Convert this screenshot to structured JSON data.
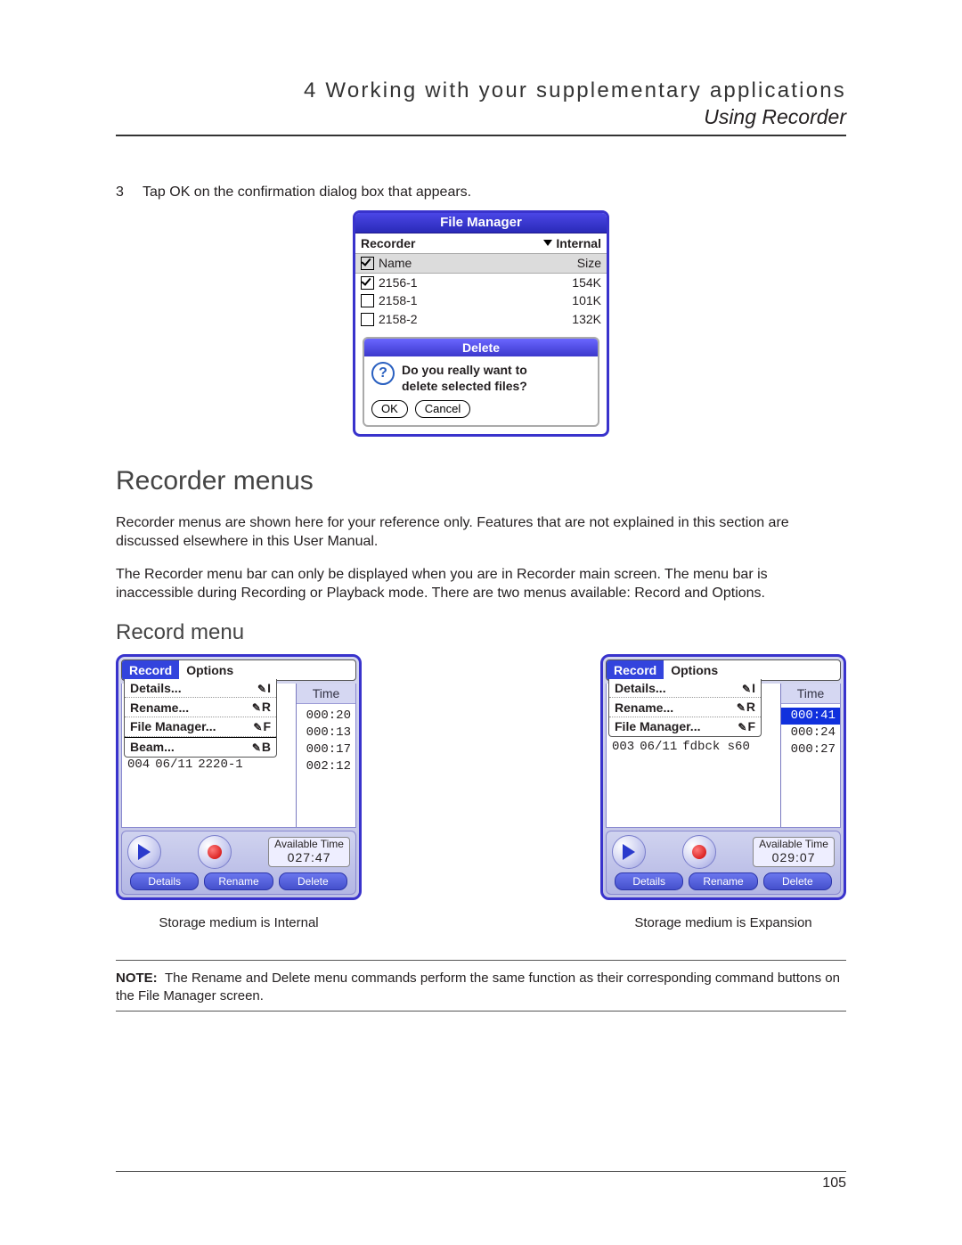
{
  "header": {
    "chapter": "4 Working with your supplementary applications",
    "subtitle": "Using Recorder"
  },
  "step": {
    "num": "3",
    "text": "Tap OK on the confirmation dialog box that appears."
  },
  "filemanager": {
    "title": "File Manager",
    "app": "Recorder",
    "storage": "Internal",
    "cols": {
      "name": "Name",
      "size": "Size"
    },
    "rows": [
      {
        "checked": true,
        "name": "2156-1",
        "size": "154K"
      },
      {
        "checked": false,
        "name": "2158-1",
        "size": "101K"
      },
      {
        "checked": false,
        "name": "2158-2",
        "size": "132K"
      }
    ],
    "dialog": {
      "title": "Delete",
      "line1": "Do you really want to",
      "line2": "delete selected files?",
      "ok": "OK",
      "cancel": "Cancel"
    }
  },
  "section": {
    "title": "Recorder menus",
    "para1": "Recorder menus are shown here for your reference only. Features that are not explained in this section are discussed elsewhere in this User Manual.",
    "para2": "The Recorder menu bar can only be displayed when you are in Recorder main screen. The menu bar is inaccessible during Recording or Playback mode. There are two menus available: Record and Options.",
    "subtitle": "Record menu"
  },
  "menu": {
    "record": "Record",
    "options": "Options",
    "items": {
      "details": {
        "label": "Details...",
        "short": "I"
      },
      "rename": {
        "label": "Rename...",
        "short": "R"
      },
      "fmgr": {
        "label": "File Manager...",
        "short": "F"
      },
      "beam": {
        "label": "Beam...",
        "short": "B"
      }
    }
  },
  "recA": {
    "timehead": "Time",
    "times": [
      "000:20",
      "000:13",
      "000:17",
      "002:12"
    ],
    "rows": [
      {
        "idx": "004",
        "date": "06/11",
        "name": "2220-1"
      }
    ],
    "available_label": "Available Time",
    "available": "027:47",
    "buttons": {
      "details": "Details",
      "rename": "Rename",
      "delete": "Delete"
    },
    "caption": "Storage medium is Internal"
  },
  "recB": {
    "timehead": "Time",
    "times_hl": "000:41",
    "times": [
      "000:24",
      "000:27"
    ],
    "rows": [
      {
        "idx": "003",
        "date": "06/11",
        "name": "fdbck s60"
      }
    ],
    "available_label": "Available Time",
    "available": "029:07",
    "buttons": {
      "details": "Details",
      "rename": "Rename",
      "delete": "Delete"
    },
    "caption": "Storage medium is Expansion"
  },
  "note": {
    "label": "NOTE:",
    "text": "The Rename and Delete menu commands perform the same function as their corresponding command buttons on the File Manager screen."
  },
  "page_number": "105"
}
